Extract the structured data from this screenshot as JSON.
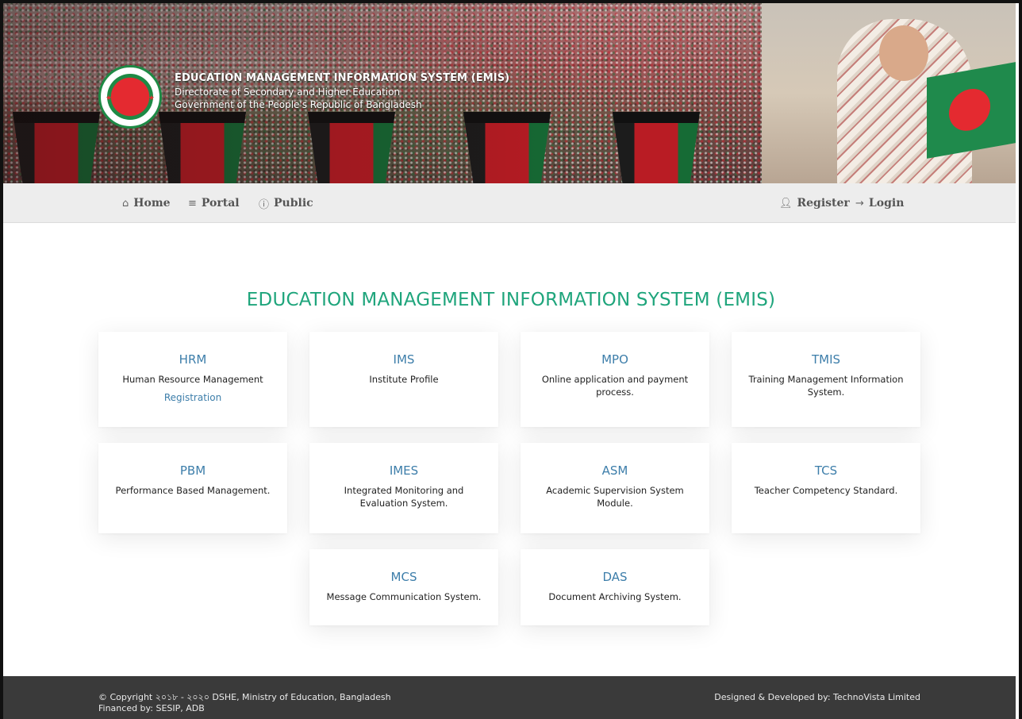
{
  "banner": {
    "title": "EDUCATION MANAGEMENT INFORMATION SYSTEM (EMIS)",
    "subtitle1": "Directorate of Secondary and Higher Education",
    "subtitle2": "Government of the People's Republic of Bangladesh"
  },
  "nav": {
    "home": {
      "label": "Home",
      "icon": "home-icon"
    },
    "portal": {
      "label": "Portal",
      "icon": "bars-icon"
    },
    "public": {
      "label": "Public",
      "icon": "info-circle-icon"
    },
    "register": {
      "label": "Register",
      "icon": "user-icon"
    },
    "login": {
      "label": "Login",
      "icon": "sign-in-icon"
    }
  },
  "main": {
    "heading": "EDUCATION MANAGEMENT INFORMATION SYSTEM (EMIS)",
    "modules": [
      {
        "title": "HRM",
        "desc": "Human Resource Management",
        "link": "Registration"
      },
      {
        "title": "IMS",
        "desc": "Institute Profile"
      },
      {
        "title": "MPO",
        "desc": "Online application and payment process."
      },
      {
        "title": "TMIS",
        "desc": "Training Management Information System."
      },
      {
        "title": "PBM",
        "desc": "Performance Based Management."
      },
      {
        "title": "IMES",
        "desc": "Integrated Monitoring and Evaluation System."
      },
      {
        "title": "ASM",
        "desc": "Academic Supervision System Module."
      },
      {
        "title": "TCS",
        "desc": "Teacher Competency Standard."
      },
      {
        "title": "MCS",
        "desc": "Message Communication System."
      },
      {
        "title": "DAS",
        "desc": "Document Archiving System."
      }
    ]
  },
  "footer": {
    "copyright": "© Copyright ২০১৮ - ২০২০ DSHE, Ministry of Education, Bangladesh",
    "financed": "Financed by: SESIP, ADB",
    "developer": "Designed & Developed by: TechnoVista Limited"
  },
  "colors": {
    "heading": "#1fa57c",
    "module_title": "#3d7eaa",
    "nav_bg": "#ededed",
    "footer_bg": "#3a3a3a"
  }
}
